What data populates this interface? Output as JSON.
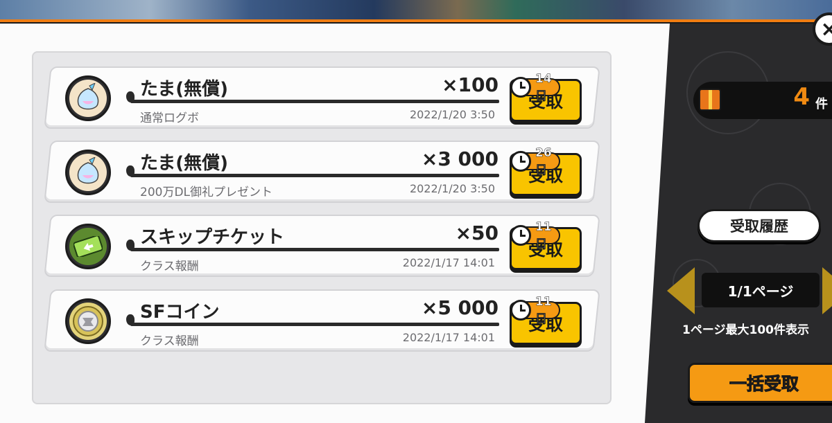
{
  "header": {
    "close_label": "×"
  },
  "rewards": [
    {
      "name": "たま(無償)",
      "qty": "×100",
      "source": "通常ログボ",
      "date": "2022/1/20 3:50",
      "days_left": "14日",
      "claim_label": "受取",
      "icon": "tama-icon"
    },
    {
      "name": "たま(無償)",
      "qty": "×3 000",
      "source": "200万DL御礼プレゼント",
      "date": "2022/1/20 3:50",
      "days_left": "26日",
      "claim_label": "受取",
      "icon": "tama-icon"
    },
    {
      "name": "スキップチケット",
      "qty": "×50",
      "source": "クラス報酬",
      "date": "2022/1/17 14:01",
      "days_left": "11日",
      "claim_label": "受取",
      "icon": "ticket-icon"
    },
    {
      "name": "SFコイン",
      "qty": "×5 000",
      "source": "クラス報酬",
      "date": "2022/1/17 14:01",
      "days_left": "11日",
      "claim_label": "受取",
      "icon": "coin-icon"
    }
  ],
  "sidebar": {
    "count": {
      "value": "4",
      "unit": "件",
      "icon": "gift-icon"
    },
    "history_label": "受取履歴",
    "page_label": "1/1ページ",
    "page_note": "1ページ最大100件表示",
    "claim_all_label": "一括受取"
  },
  "colors": {
    "accent_orange": "#f07d12",
    "button_yellow": "#f9c400",
    "dark_panel": "#2a2a2c",
    "arrow_gold": "#b8911c"
  }
}
